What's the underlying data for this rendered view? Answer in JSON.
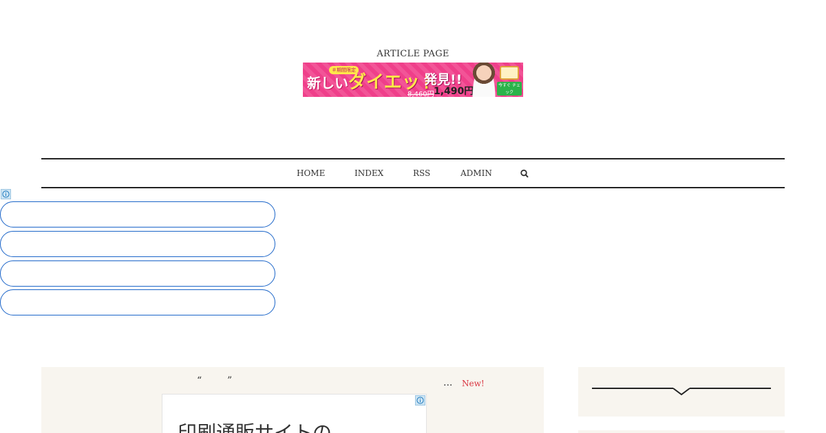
{
  "header": {
    "site_title": "ARTICLE PAGE",
    "banner": {
      "tag": "＃期間限定",
      "text_a": "新しい",
      "text_b": "ダイエット",
      "text_c": "発見!!",
      "old_price": "8,460円",
      "new_price": "1,490円",
      "cta": "今すぐ チェック"
    }
  },
  "nav": {
    "items": [
      "HOME",
      "INDEX",
      "RSS",
      "ADMIN"
    ],
    "search_icon": "search-icon"
  },
  "ads": {
    "info_icon": "info-icon",
    "pill_count": 4
  },
  "main": {
    "quote_open": "“",
    "quote_close": "”",
    "ellipsis": "...",
    "new_badge": "New!",
    "inner_ad_text": "印刷通販サイトの"
  },
  "colors": {
    "nav_border": "#222222",
    "ad_pill_border": "#1a64c8",
    "panel_bg": "#f8f5ef",
    "new_badge": "#d9333f",
    "banner_pink": "#ef3f8a"
  }
}
